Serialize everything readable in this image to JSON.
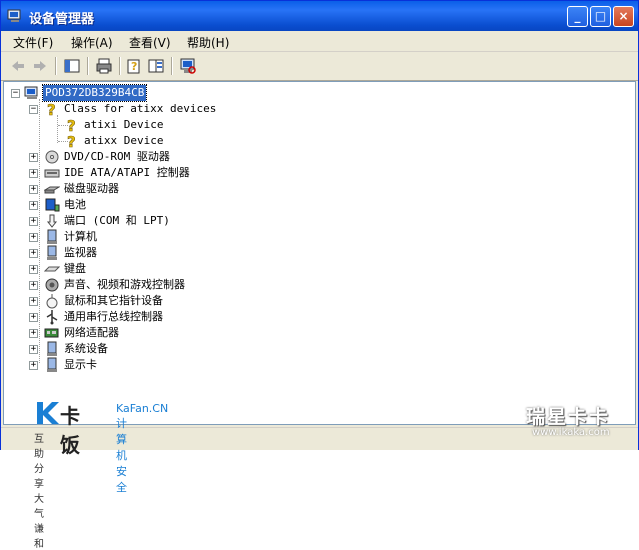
{
  "window": {
    "title": "设备管理器"
  },
  "menu": [
    {
      "label": "文件(F)"
    },
    {
      "label": "操作(A)"
    },
    {
      "label": "查看(V)"
    },
    {
      "label": "帮助(H)"
    }
  ],
  "tree": {
    "root": "POD372DB329B4CB",
    "class_node": "Class for atixx devices",
    "devices": [
      "atixi Device",
      "atixx Device"
    ],
    "categories": [
      {
        "label": "DVD/CD-ROM 驱动器",
        "icon": "cdrom-icon"
      },
      {
        "label": "IDE ATA/ATAPI 控制器",
        "icon": "ide-controller-icon"
      },
      {
        "label": "磁盘驱动器",
        "icon": "disk-drive-icon"
      },
      {
        "label": "电池",
        "icon": "battery-icon"
      },
      {
        "label": "端口 (COM 和 LPT)",
        "icon": "port-icon"
      },
      {
        "label": "计算机",
        "icon": "computer-icon"
      },
      {
        "label": "监视器",
        "icon": "monitor-icon"
      },
      {
        "label": "键盘",
        "icon": "keyboard-icon"
      },
      {
        "label": "声音、视频和游戏控制器",
        "icon": "sound-icon"
      },
      {
        "label": "鼠标和其它指针设备",
        "icon": "mouse-icon"
      },
      {
        "label": "通用串行总线控制器",
        "icon": "usb-icon"
      },
      {
        "label": "网络适配器",
        "icon": "network-adapter-icon"
      },
      {
        "label": "系统设备",
        "icon": "system-device-icon"
      },
      {
        "label": "显示卡",
        "icon": "display-adapter-icon"
      }
    ]
  },
  "watermarks": {
    "kafan_cn": "卡饭",
    "kafan_en": "KaFan.CN",
    "kafan_sub": "计算机安全",
    "kafan_slogan": "互助分享  大气谦和",
    "ikaka_cn": "瑞星卡卡",
    "ikaka_url": "www.ikaka.com"
  }
}
